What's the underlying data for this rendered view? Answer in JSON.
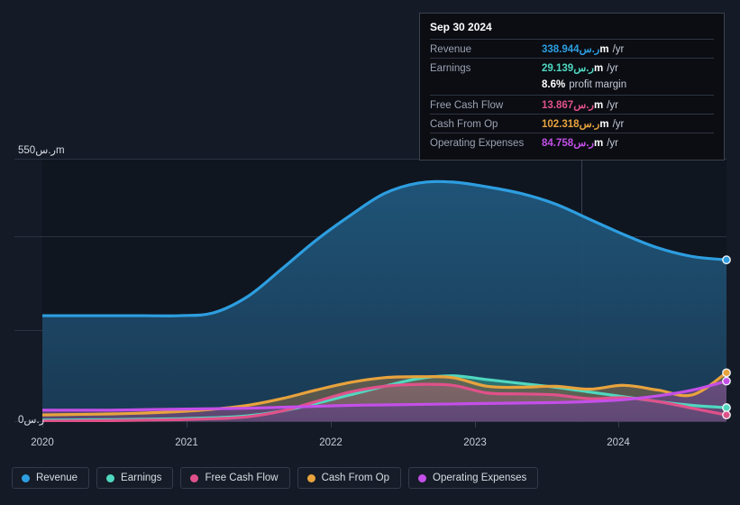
{
  "currency_symbol": "ر.س",
  "chart_data": {
    "type": "area",
    "title": "",
    "xlabel": "",
    "ylabel": "",
    "grid": true,
    "legend_position": "bottom",
    "ylim": [
      0,
      550
    ],
    "xlim": [
      "2019-09",
      "2024-09"
    ],
    "y_ticks": [
      {
        "value": 550,
        "label": "550ر.سm"
      },
      {
        "value": 0,
        "label": "0ر.س"
      }
    ],
    "x_ticks": [
      "2020",
      "2021",
      "2022",
      "2023",
      "2024"
    ],
    "x": [
      "2019-09",
      "2019-12",
      "2020-03",
      "2020-06",
      "2020-09",
      "2020-12",
      "2021-03",
      "2021-06",
      "2021-09",
      "2021-12",
      "2022-03",
      "2022-06",
      "2022-09",
      "2022-12",
      "2023-03",
      "2023-06",
      "2023-09",
      "2023-12",
      "2024-03",
      "2024-06",
      "2024-09"
    ],
    "series": [
      {
        "name": "Revenue",
        "color": "#2d9ee0",
        "fill": "#1d4561",
        "values": [
          222,
          222,
          222,
          222,
          222,
          228,
          262,
          320,
          380,
          432,
          478,
          500,
          502,
          492,
          478,
          456,
          424,
          392,
          364,
          346,
          338.944
        ]
      },
      {
        "name": "Earnings",
        "color": "#4fd8c0",
        "fill": "#2a6a68",
        "values": [
          3,
          3.5,
          4,
          5,
          6,
          8,
          12,
          22,
          38,
          56,
          74,
          90,
          96,
          88,
          80,
          72,
          62,
          52,
          42,
          34,
          29.139
        ]
      },
      {
        "name": "Free Cash Flow",
        "color": "#e0518a",
        "fill": "#7a5560",
        "values": [
          1,
          1.5,
          2,
          3,
          4,
          6,
          10,
          22,
          42,
          62,
          74,
          78,
          76,
          60,
          58,
          56,
          48,
          50,
          42,
          28,
          13.867
        ]
      },
      {
        "name": "Cash From Op",
        "color": "#e8a33d",
        "fill": "#6b5c44",
        "values": [
          14,
          15,
          16,
          18,
          21,
          26,
          34,
          48,
          66,
          82,
          92,
          94,
          92,
          74,
          72,
          74,
          68,
          76,
          66,
          56,
          102.318
        ]
      },
      {
        "name": "Operating Expenses",
        "color": "#c44fe8",
        "fill": "#5b3f77",
        "values": [
          24,
          24,
          24,
          25,
          26,
          27,
          28,
          30,
          32,
          34,
          35,
          36,
          37,
          38,
          39,
          40,
          42,
          46,
          54,
          66,
          84.758
        ]
      }
    ]
  },
  "tooltip": {
    "date": "Sep 30 2024",
    "unit_suffix": "m",
    "per_year": "/yr",
    "rows": [
      {
        "label": "Revenue",
        "value": "338.944",
        "currency": "ر.س",
        "unit": "m",
        "suffix": "/yr",
        "color": "#2d9ee0"
      },
      {
        "label": "Earnings",
        "value": "29.139",
        "currency": "ر.س",
        "unit": "m",
        "suffix": "/yr",
        "color": "#4fd8c0"
      },
      {
        "label": "",
        "value": "8.6%",
        "currency": "",
        "unit": "",
        "suffix": "profit margin",
        "color": "#ffffff"
      },
      {
        "label": "Free Cash Flow",
        "value": "13.867",
        "currency": "ر.س",
        "unit": "m",
        "suffix": "/yr",
        "color": "#e0518a"
      },
      {
        "label": "Cash From Op",
        "value": "102.318",
        "currency": "ر.س",
        "unit": "m",
        "suffix": "/yr",
        "color": "#e8a33d"
      },
      {
        "label": "Operating Expenses",
        "value": "84.758",
        "currency": "ر.س",
        "unit": "m",
        "suffix": "/yr",
        "color": "#c44fe8"
      }
    ]
  },
  "legend": {
    "items": [
      {
        "label": "Revenue",
        "color": "#2d9ee0"
      },
      {
        "label": "Earnings",
        "color": "#4fd8c0"
      },
      {
        "label": "Free Cash Flow",
        "color": "#e0518a"
      },
      {
        "label": "Cash From Op",
        "color": "#e8a33d"
      },
      {
        "label": "Operating Expenses",
        "color": "#c44fe8"
      }
    ]
  },
  "colors": {
    "background": "#141a26",
    "plot_background": "#101620",
    "grid": "#2a3240",
    "divider": "#39414f",
    "text": "#d6dae2",
    "muted_text": "#9aa2b1"
  }
}
